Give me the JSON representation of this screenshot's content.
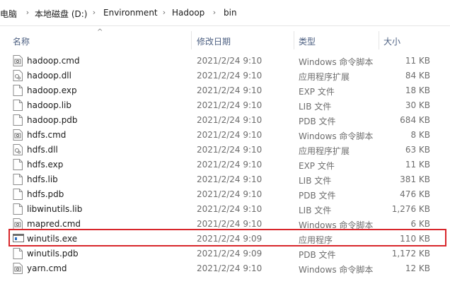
{
  "breadcrumb": {
    "items": [
      "电脑",
      "本地磁盘 (D:)",
      "Environment",
      "Hadoop",
      "bin"
    ]
  },
  "columns": {
    "name": "名称",
    "modified": "修改日期",
    "type": "类型",
    "size": "大小"
  },
  "files": [
    {
      "name": "hadoop.cmd",
      "modified": "2021/2/24 9:10",
      "type": "Windows 命令脚本",
      "size": "11 KB",
      "icon": "cmd-file-icon"
    },
    {
      "name": "hadoop.dll",
      "modified": "2021/2/24 9:10",
      "type": "应用程序扩展",
      "size": "84 KB",
      "icon": "dll-file-icon"
    },
    {
      "name": "hadoop.exp",
      "modified": "2021/2/24 9:10",
      "type": "EXP 文件",
      "size": "18 KB",
      "icon": "blank-file-icon"
    },
    {
      "name": "hadoop.lib",
      "modified": "2021/2/24 9:10",
      "type": "LIB 文件",
      "size": "30 KB",
      "icon": "blank-file-icon"
    },
    {
      "name": "hadoop.pdb",
      "modified": "2021/2/24 9:10",
      "type": "PDB 文件",
      "size": "684 KB",
      "icon": "blank-file-icon"
    },
    {
      "name": "hdfs.cmd",
      "modified": "2021/2/24 9:10",
      "type": "Windows 命令脚本",
      "size": "8 KB",
      "icon": "cmd-file-icon"
    },
    {
      "name": "hdfs.dll",
      "modified": "2021/2/24 9:10",
      "type": "应用程序扩展",
      "size": "63 KB",
      "icon": "dll-file-icon"
    },
    {
      "name": "hdfs.exp",
      "modified": "2021/2/24 9:10",
      "type": "EXP 文件",
      "size": "11 KB",
      "icon": "blank-file-icon"
    },
    {
      "name": "hdfs.lib",
      "modified": "2021/2/24 9:10",
      "type": "LIB 文件",
      "size": "381 KB",
      "icon": "blank-file-icon"
    },
    {
      "name": "hdfs.pdb",
      "modified": "2021/2/24 9:10",
      "type": "PDB 文件",
      "size": "476 KB",
      "icon": "blank-file-icon"
    },
    {
      "name": "libwinutils.lib",
      "modified": "2021/2/24 9:10",
      "type": "LIB 文件",
      "size": "1,276 KB",
      "icon": "blank-file-icon"
    },
    {
      "name": "mapred.cmd",
      "modified": "2021/2/24 9:10",
      "type": "Windows 命令脚本",
      "size": "6 KB",
      "icon": "cmd-file-icon"
    },
    {
      "name": "winutils.exe",
      "modified": "2021/2/24 9:09",
      "type": "应用程序",
      "size": "110 KB",
      "icon": "exe-file-icon"
    },
    {
      "name": "winutils.pdb",
      "modified": "2021/2/24 9:09",
      "type": "PDB 文件",
      "size": "1,172 KB",
      "icon": "blank-file-icon"
    },
    {
      "name": "yarn.cmd",
      "modified": "2021/2/24 9:10",
      "type": "Windows 命令脚本",
      "size": "12 KB",
      "icon": "cmd-file-icon"
    }
  ],
  "highlighted_file": "winutils.exe",
  "colors": {
    "highlight_border": "#d8262b",
    "header_text": "#4d6082",
    "detail_text": "#6d6d6d"
  }
}
